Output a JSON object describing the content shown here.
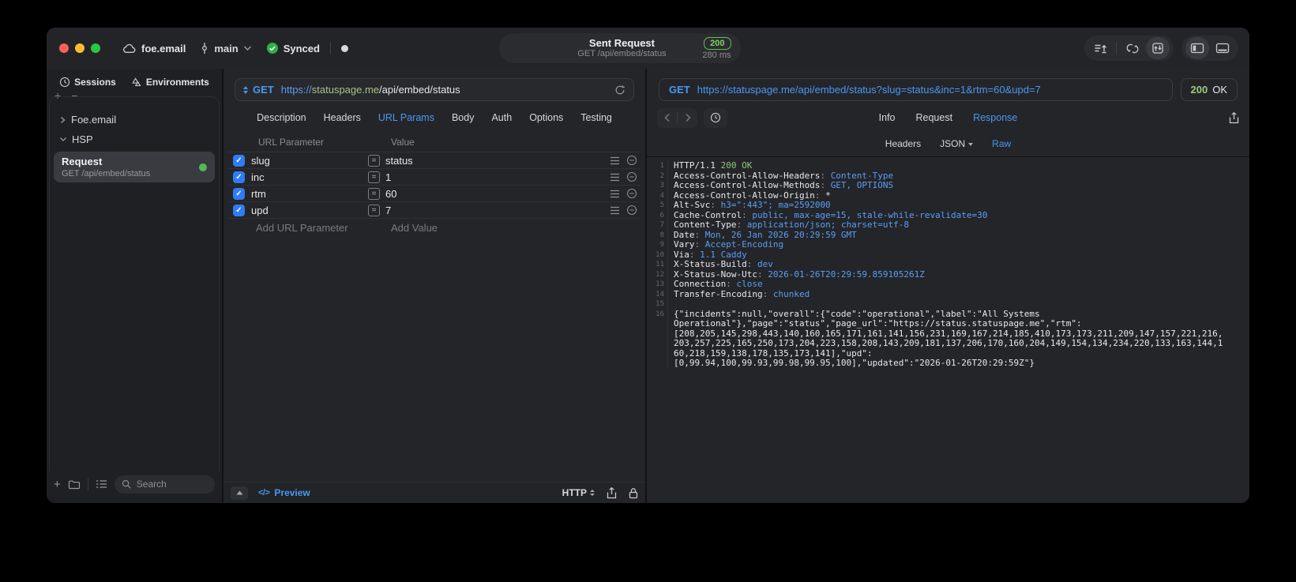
{
  "titlebar": {
    "project": "foe.email",
    "branch": "main",
    "sync_status": "Synced",
    "request_title": "Sent Request",
    "request_subtitle": "GET /api/embed/status",
    "status_code": "200",
    "duration": "280 ms"
  },
  "sidebar": {
    "tabs": [
      {
        "label": "Sessions"
      },
      {
        "label": "Environments"
      }
    ],
    "tree": [
      {
        "label": "Foe.email",
        "expanded": false
      },
      {
        "label": "HSP",
        "expanded": true
      }
    ],
    "request_item": {
      "title": "Request",
      "subtitle": "GET /api/embed/status"
    },
    "search_placeholder": "Search"
  },
  "request_pane": {
    "method": "GET",
    "url": {
      "scheme": "https://",
      "host": "statuspage.me",
      "path": "/api/embed/status"
    },
    "tabs": [
      "Description",
      "Headers",
      "URL Params",
      "Body",
      "Auth",
      "Options",
      "Testing"
    ],
    "active_tab": "URL Params",
    "table": {
      "columns": [
        "URL Parameter",
        "Value"
      ],
      "rows": [
        {
          "name": "slug",
          "value": "status",
          "checked": true
        },
        {
          "name": "inc",
          "value": "1",
          "checked": true
        },
        {
          "name": "rtm",
          "value": "60",
          "checked": true
        },
        {
          "name": "upd",
          "value": "7",
          "checked": true
        }
      ],
      "add_name": "Add URL Parameter",
      "add_value": "Add Value"
    },
    "footer": {
      "preview": "Preview",
      "code_glyph": "</>",
      "protocol": "HTTP"
    }
  },
  "response_pane": {
    "method": "GET",
    "url": "https://statuspage.me/api/embed/status?slug=status&inc=1&rtm=60&upd=7",
    "status_code": "200",
    "status_text": "OK",
    "tabs": [
      "Info",
      "Request",
      "Response"
    ],
    "active_tab": "Response",
    "subtabs": [
      "Headers",
      "JSON",
      "Raw"
    ],
    "active_subtab": "Raw",
    "raw": [
      {
        "n": 1,
        "seg": [
          [
            "HTTP/1.1 ",
            "p"
          ],
          [
            "200 OK",
            "g"
          ]
        ]
      },
      {
        "n": 2,
        "seg": [
          [
            "Access-Control-Allow-Headers",
            "p"
          ],
          [
            ": ",
            "d"
          ],
          [
            "Content-Type",
            "b"
          ]
        ]
      },
      {
        "n": 3,
        "seg": [
          [
            "Access-Control-Allow-Methods",
            "p"
          ],
          [
            ": ",
            "d"
          ],
          [
            "GET, OPTIONS",
            "b"
          ]
        ]
      },
      {
        "n": 4,
        "seg": [
          [
            "Access-Control-Allow-Origin",
            "p"
          ],
          [
            ": ",
            "d"
          ],
          [
            "*",
            "p"
          ]
        ]
      },
      {
        "n": 5,
        "seg": [
          [
            "Alt-Svc",
            "p"
          ],
          [
            ": ",
            "d"
          ],
          [
            "h3=\":443\"; ma=2592000",
            "b"
          ]
        ]
      },
      {
        "n": 6,
        "seg": [
          [
            "Cache-Control",
            "p"
          ],
          [
            ": ",
            "d"
          ],
          [
            "public, max-age=15, stale-while-revalidate=30",
            "b"
          ]
        ]
      },
      {
        "n": 7,
        "seg": [
          [
            "Content-Type",
            "p"
          ],
          [
            ": ",
            "d"
          ],
          [
            "application/json; charset=utf-8",
            "b"
          ]
        ]
      },
      {
        "n": 8,
        "seg": [
          [
            "Date",
            "p"
          ],
          [
            ": ",
            "d"
          ],
          [
            "Mon, 26 Jan 2026 20:29:59 GMT",
            "b"
          ]
        ]
      },
      {
        "n": 9,
        "seg": [
          [
            "Vary",
            "p"
          ],
          [
            ": ",
            "d"
          ],
          [
            "Accept-Encoding",
            "b"
          ]
        ]
      },
      {
        "n": 10,
        "seg": [
          [
            "Via",
            "p"
          ],
          [
            ": ",
            "d"
          ],
          [
            "1.1 Caddy",
            "b"
          ]
        ]
      },
      {
        "n": 11,
        "seg": [
          [
            "X-Status-Build",
            "p"
          ],
          [
            ": ",
            "d"
          ],
          [
            "dev",
            "b"
          ]
        ]
      },
      {
        "n": 12,
        "seg": [
          [
            "X-Status-Now-Utc",
            "p"
          ],
          [
            ": ",
            "d"
          ],
          [
            "2026-01-26T20:29:59.859105261Z",
            "b"
          ]
        ]
      },
      {
        "n": 13,
        "seg": [
          [
            "Connection",
            "p"
          ],
          [
            ": ",
            "d"
          ],
          [
            "close",
            "b"
          ]
        ]
      },
      {
        "n": 14,
        "seg": [
          [
            "Transfer-Encoding",
            "p"
          ],
          [
            ": ",
            "d"
          ],
          [
            "chunked",
            "b"
          ]
        ]
      },
      {
        "n": 15,
        "seg": []
      },
      {
        "n": 16,
        "lines": [
          "{\"incidents\":null,\"overall\":{\"code\":\"operational\",\"label\":\"All Systems",
          "Operational\"},\"page\":\"status\",\"page_url\":\"https://status.statuspage.me\",\"rtm\":",
          "[208,205,145,298,443,140,160,165,171,161,141,156,231,169,167,214,185,410,173,173,211,209,147,157,221,216,",
          "203,257,225,165,250,173,204,223,158,208,143,209,181,137,206,170,160,204,149,154,134,234,220,133,163,144,1",
          "60,218,159,138,178,135,173,141],\"upd\":",
          "[0,99.94,100,99.93,99.98,99.95,100],\"updated\":\"2026-01-26T20:29:59Z\"}"
        ]
      }
    ],
    "body": "{\"incidents\":null,\"overall\":{\"code\":\"operational\",\"label\":\"All Systems Operational\"},\"page\":\"status\",\"page_url\":\"https://status.statuspage.me\",\"rtm\":[208,205,145,298,443,140,160,165,171,161,141,156,231,169,167,214,185,410,173,173,211,209,147,157,221,216,203,257,225,165,250,173,204,223,158,208,143,209,181,137,206,170,160,204,149,154,134,234,220,133,163,144,160,218,159,138,178,135,173,141],\"upd\":[0,99.94,100,99.93,99.98,99.95,100],\"updated\":\"2026-01-26T20:29:59Z\"}"
  },
  "colors": {
    "accent_blue": "#4A97F3",
    "status_green": "#7FD466",
    "mono_value_blue": "#5B9EF4",
    "mono_green": "#8FC979",
    "host_green": "#A6C284",
    "checkbox_blue": "#2F7CF6"
  }
}
